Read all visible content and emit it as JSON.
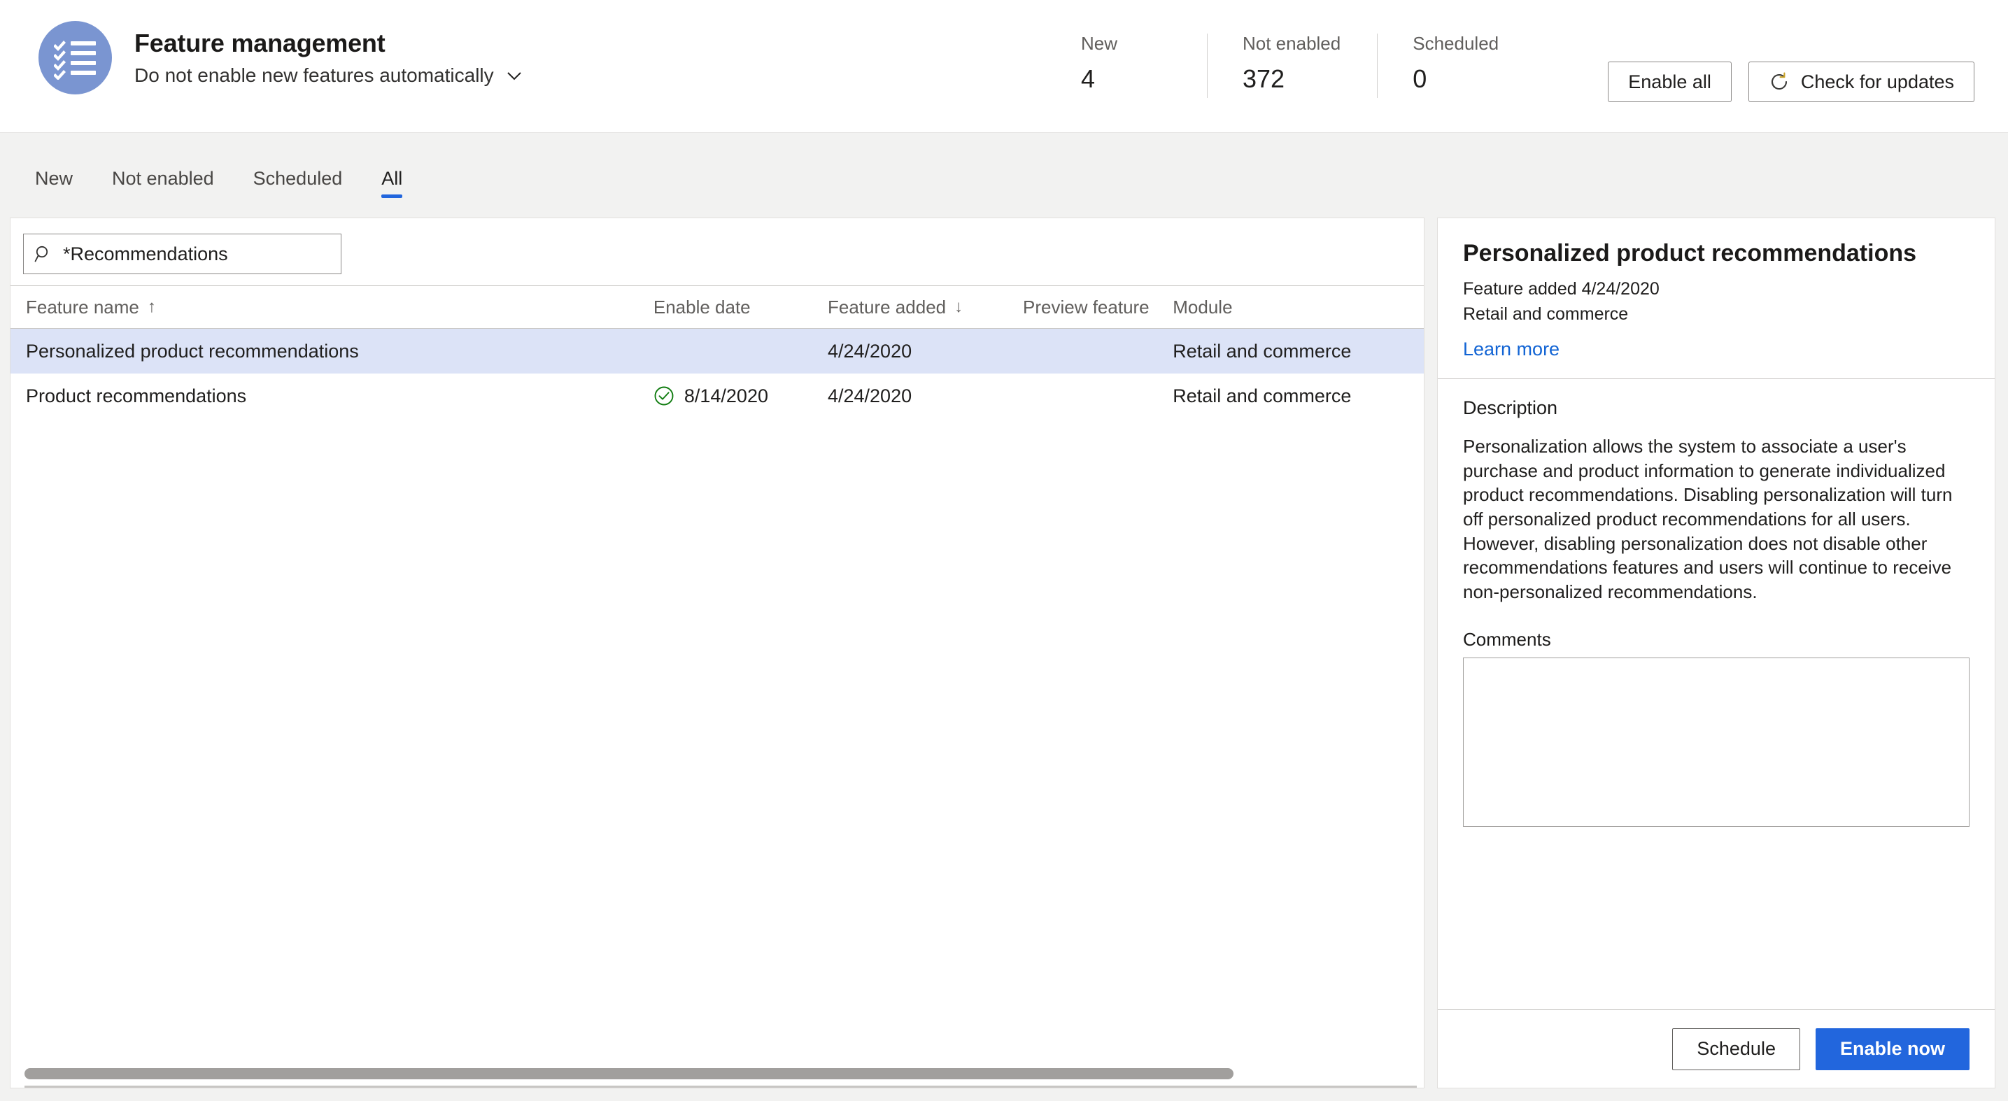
{
  "header": {
    "icon_name": "feature-checklist-icon",
    "title": "Feature management",
    "auto_enable_setting": "Do not enable new features automatically",
    "chevron_icon": "chevron-down-icon",
    "stats": [
      {
        "label": "New",
        "value": "4"
      },
      {
        "label": "Not enabled",
        "value": "372"
      },
      {
        "label": "Scheduled",
        "value": "0"
      }
    ],
    "enable_all_label": "Enable all",
    "check_updates_label": "Check for updates",
    "check_updates_icon": "refresh-icon"
  },
  "tabs": [
    {
      "label": "New",
      "active": false
    },
    {
      "label": "Not enabled",
      "active": false
    },
    {
      "label": "Scheduled",
      "active": false
    },
    {
      "label": "All",
      "active": true
    }
  ],
  "list": {
    "search": {
      "icon": "search-icon",
      "value": "*Recommendations",
      "placeholder": "Filter"
    },
    "columns": [
      {
        "label": "Feature name",
        "sort": "↑"
      },
      {
        "label": "Enable date",
        "sort": ""
      },
      {
        "label": "Feature added",
        "sort": "↓"
      },
      {
        "label": "Preview feature",
        "sort": ""
      },
      {
        "label": "Module",
        "sort": ""
      }
    ],
    "rows": [
      {
        "feature_name": "Personalized product recommendations",
        "enable_date": "",
        "enabled_icon": "",
        "feature_added": "4/24/2020",
        "preview_feature": "",
        "module": "Retail and commerce",
        "selected": true
      },
      {
        "feature_name": "Product recommendations",
        "enable_date": "8/14/2020",
        "enabled_icon": "green-check-circle-icon",
        "feature_added": "4/24/2020",
        "preview_feature": "",
        "module": "Retail and commerce",
        "selected": false
      }
    ]
  },
  "detail": {
    "title": "Personalized product recommendations",
    "feature_added": "Feature added 4/24/2020",
    "module": "Retail and commerce",
    "learn_more_label": "Learn more",
    "description_label": "Description",
    "description_text": "Personalization allows the system to associate a user's purchase and product information to generate individualized product recommendations. Disabling personalization will turn off personalized product recommendations for all users. However, disabling personalization does not disable other recommendations features and users will continue to receive non-personalized recommendations.",
    "comments_label": "Comments",
    "comments_value": "",
    "comments_placeholder": "",
    "schedule_label": "Schedule",
    "enable_now_label": "Enable now"
  },
  "colors": {
    "accent_blue": "#2266dd",
    "link_blue": "#1264d4",
    "selected_row": "#dce3f7",
    "icon_circle": "#7a95d1",
    "enabled_green": "#107c10",
    "page_bg": "#f2f2f1"
  }
}
